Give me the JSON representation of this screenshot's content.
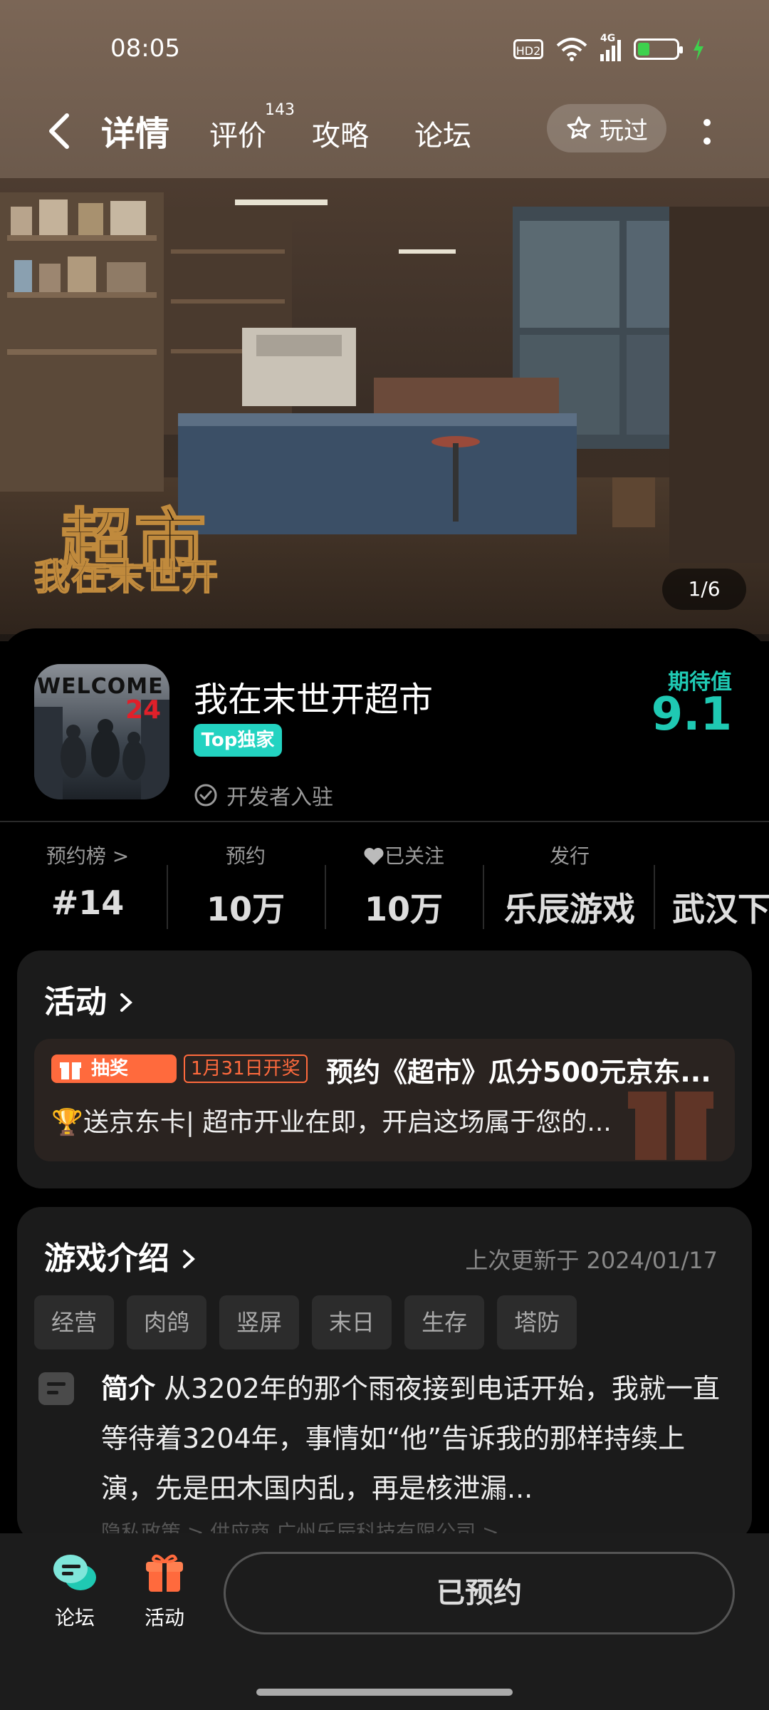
{
  "status_bar": {
    "time": "08:05",
    "hd_label": "HD2",
    "network_label": "4G",
    "battery_level": 0.3
  },
  "nav": {
    "tabs": [
      {
        "label": "详情"
      },
      {
        "label": "评价"
      },
      {
        "label": "攻略"
      },
      {
        "label": "论坛"
      }
    ],
    "review_count": "143",
    "played_label": "玩过"
  },
  "banner": {
    "art_title_line1": "超市",
    "art_title_line2": "我在末世开",
    "page_indicator": "1/6"
  },
  "game": {
    "icon_text": "WELCOME",
    "icon_number": "24",
    "name": "我在末世开超市",
    "badge": "Top独家",
    "developer_status": "开发者入驻",
    "expectation_label": "期待值",
    "expectation_score": "9.1"
  },
  "stats": [
    {
      "label": "预约榜 >",
      "value": "#14"
    },
    {
      "label": "预约",
      "value": "10万"
    },
    {
      "label": "已关注",
      "value": "10万"
    },
    {
      "label": "发行",
      "value": "乐辰游戏"
    },
    {
      "label": "",
      "value": "武汉下"
    }
  ],
  "activity": {
    "title": "活动",
    "tag_lottery": "抽奖",
    "tag_date": "1月31日开奖",
    "event_title": "预约《超市》瓜分500元京东...",
    "event_sub": "🏆送京东卡| 超市开业在即，开启这场属于您的..."
  },
  "intro": {
    "title": "游戏介绍",
    "updated": "上次更新于 2024/01/17",
    "tags": [
      "经营",
      "肉鸽",
      "竖屏",
      "末日",
      "生存",
      "塔防"
    ],
    "summary_label": "简介",
    "summary_text": "从3202年的那个雨夜接到电话开始，我就一直等待着3204年，事情如“他”告诉我的那样持续上演，先是田木国内乱，再是核泄漏...",
    "links": "隐私政策 >    供应商 广州乐辰科技有限公司 >"
  },
  "bottom_bar": {
    "forum_label": "论坛",
    "activity_label": "活动",
    "reserve_label": "已预约"
  },
  "colors": {
    "accent": "#1fc9b3",
    "orange": "#ff6a3d",
    "background": "#000000",
    "card": "#1b1b1b"
  }
}
